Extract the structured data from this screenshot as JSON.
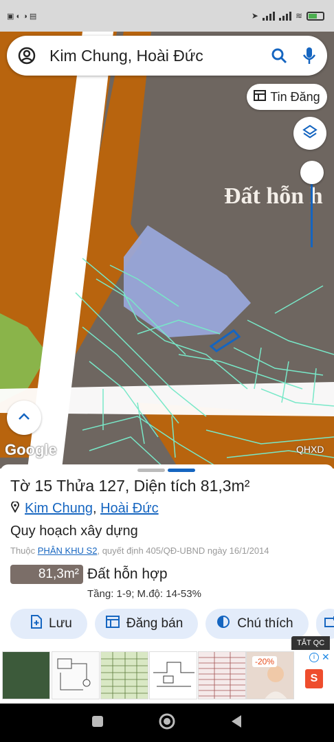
{
  "status": {
    "time": "",
    "battery": ""
  },
  "search": {
    "text": "Kim Chung, Hoài Đức"
  },
  "tin_dang": {
    "label": "Tin Đăng"
  },
  "map": {
    "label_land": "Đất hỗn h",
    "google": "Google",
    "layer_badge": "QHXD"
  },
  "parcel": {
    "title": "Tờ 15 Thửa 127, Diện tích 81,3m²",
    "commune": "Kim Chung",
    "separator": ",",
    "district": "Hoài Đức",
    "plan_title": "Quy hoạch xây dựng",
    "source_prefix": "Thuộc",
    "source_link": "PHÂN KHU S2",
    "source_suffix": ", quyết định 405/QĐ-UBND ngày 16/1/2014",
    "area": "81,3m²",
    "land_type": "Đất hỗn hợp",
    "land_detail": "Tầng: 1-9; M.độ: 14-53%"
  },
  "actions": {
    "save": "Lưu",
    "post": "Đăng bán",
    "legend": "Chú thích"
  },
  "ad": {
    "close": "TẮT QC",
    "discount": "-20%"
  },
  "colors": {
    "accent": "#1565c0",
    "chip_bg": "#e3ecfa",
    "area_bg": "#7b6e68",
    "map_orange": "#b8640e",
    "map_gray": "#6e6660",
    "map_road": "#ffffff",
    "parcel_fill": "#9aaae0",
    "parcel_line": "#78e8c8"
  }
}
